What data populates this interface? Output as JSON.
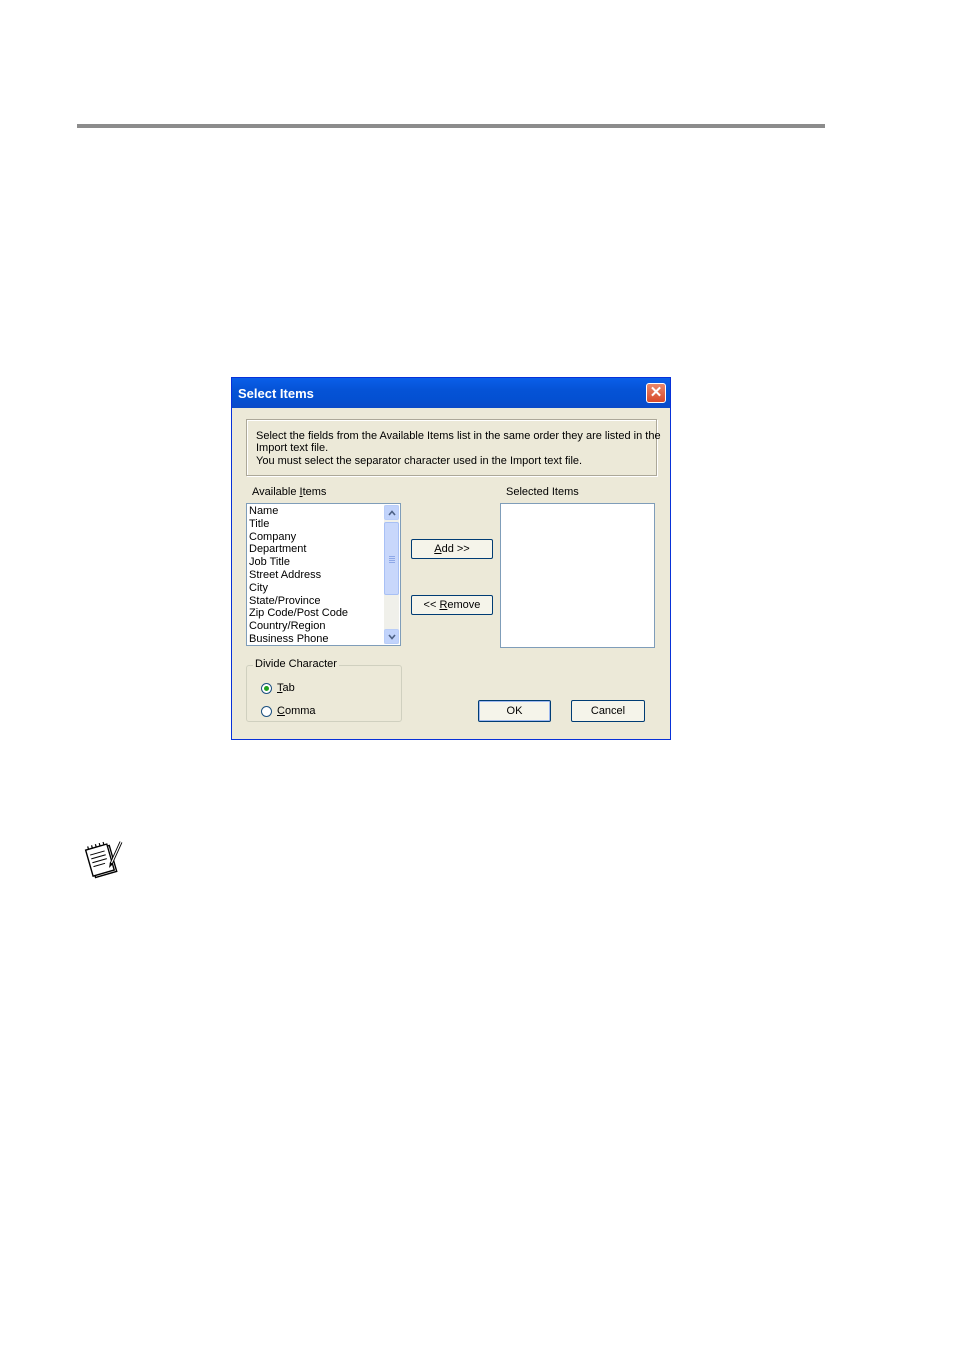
{
  "dialog": {
    "title": "Select Items",
    "close_glyph": "✕",
    "info_lines": [
      "Select the fields from the Available Items list in the same order they are listed in the",
      "Import text file.",
      "You must select the separator character used in the Import text file."
    ],
    "available": {
      "label_pre": "Available ",
      "label_u": "I",
      "label_post": "tems",
      "items": [
        "Name",
        "Title",
        "Company",
        "Department",
        "Job Title",
        "Street Address",
        "City",
        "State/Province",
        "Zip Code/Post Code",
        "Country/Region",
        "Business Phone"
      ]
    },
    "selected": {
      "label": "Selected Items",
      "items": []
    },
    "add_button": {
      "u": "A",
      "rest": "dd >>"
    },
    "remove_button": {
      "pre": "<< ",
      "u": "R",
      "rest": "emove"
    },
    "divide": {
      "label": "Divide Character",
      "options": [
        {
          "u": "T",
          "rest": "ab",
          "selected": true
        },
        {
          "u": "C",
          "rest": "omma",
          "selected": false
        }
      ]
    },
    "ok_label": "OK",
    "cancel_label": "Cancel"
  },
  "icons": {
    "note": "note-pad-pencil-icon",
    "scroll_up": "arrow-up-icon",
    "scroll_down": "arrow-down-icon"
  }
}
